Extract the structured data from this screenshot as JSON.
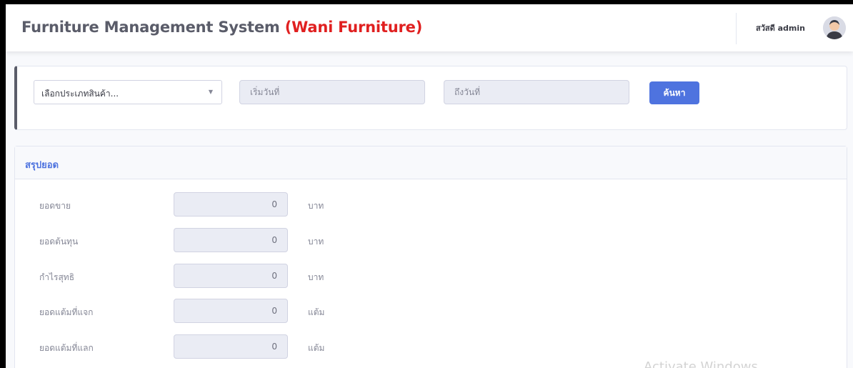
{
  "header": {
    "title_prefix": "Furniture Management System ",
    "title_brand": "(Wani Furniture)",
    "greeting": "สวัสดี admin",
    "avatar_icon": "user-avatar-icon"
  },
  "filter": {
    "category_select": {
      "selected": "เลือกประเภทสินค้า...",
      "icon": "chevron-down-icon"
    },
    "start_date": {
      "placeholder": "เริ่มวันที่",
      "value": ""
    },
    "end_date": {
      "placeholder": "ถึงวันที่",
      "value": ""
    },
    "search_label": "ค้นหา",
    "accent_color": "#4e73df"
  },
  "summary": {
    "title": "สรุปยอด",
    "rows": [
      {
        "label": "ยอดขาย",
        "value": "0",
        "unit": "บาท"
      },
      {
        "label": "ยอดต้นทุน",
        "value": "0",
        "unit": "บาท"
      },
      {
        "label": "กำไรสุทธิ",
        "value": "0",
        "unit": "บาท"
      },
      {
        "label": "ยอดแต้มที่แจก",
        "value": "0",
        "unit": "แต้ม"
      },
      {
        "label": "ยอดแต้มที่แลก",
        "value": "0",
        "unit": "แต้ม"
      }
    ]
  },
  "overlay": {
    "watermark": "Activate Windows"
  }
}
